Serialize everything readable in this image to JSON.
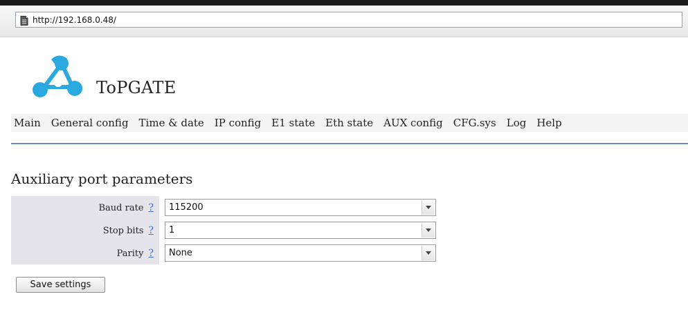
{
  "browser": {
    "url": "http://192.168.0.48/",
    "page_icon": "document-icon"
  },
  "header": {
    "brand": "ToPGATE",
    "logo_icon": "topgate-logo-icon",
    "logo_color": "#2aa9e0"
  },
  "nav": {
    "items": [
      {
        "label": "Main"
      },
      {
        "label": "General config"
      },
      {
        "label": "Time & date"
      },
      {
        "label": "IP config"
      },
      {
        "label": "E1 state"
      },
      {
        "label": "Eth state"
      },
      {
        "label": "AUX config"
      },
      {
        "label": "CFG.sys"
      },
      {
        "label": "Log"
      },
      {
        "label": "Help"
      }
    ],
    "rule_color": "#6a8ec8"
  },
  "main": {
    "title": "Auxiliary port parameters",
    "fields": [
      {
        "label": "Baud rate",
        "help": "?",
        "value": "115200"
      },
      {
        "label": "Stop bits",
        "help": "?",
        "value": "1"
      },
      {
        "label": "Parity",
        "help": "?",
        "value": "None"
      }
    ],
    "save_label": "Save settings"
  }
}
